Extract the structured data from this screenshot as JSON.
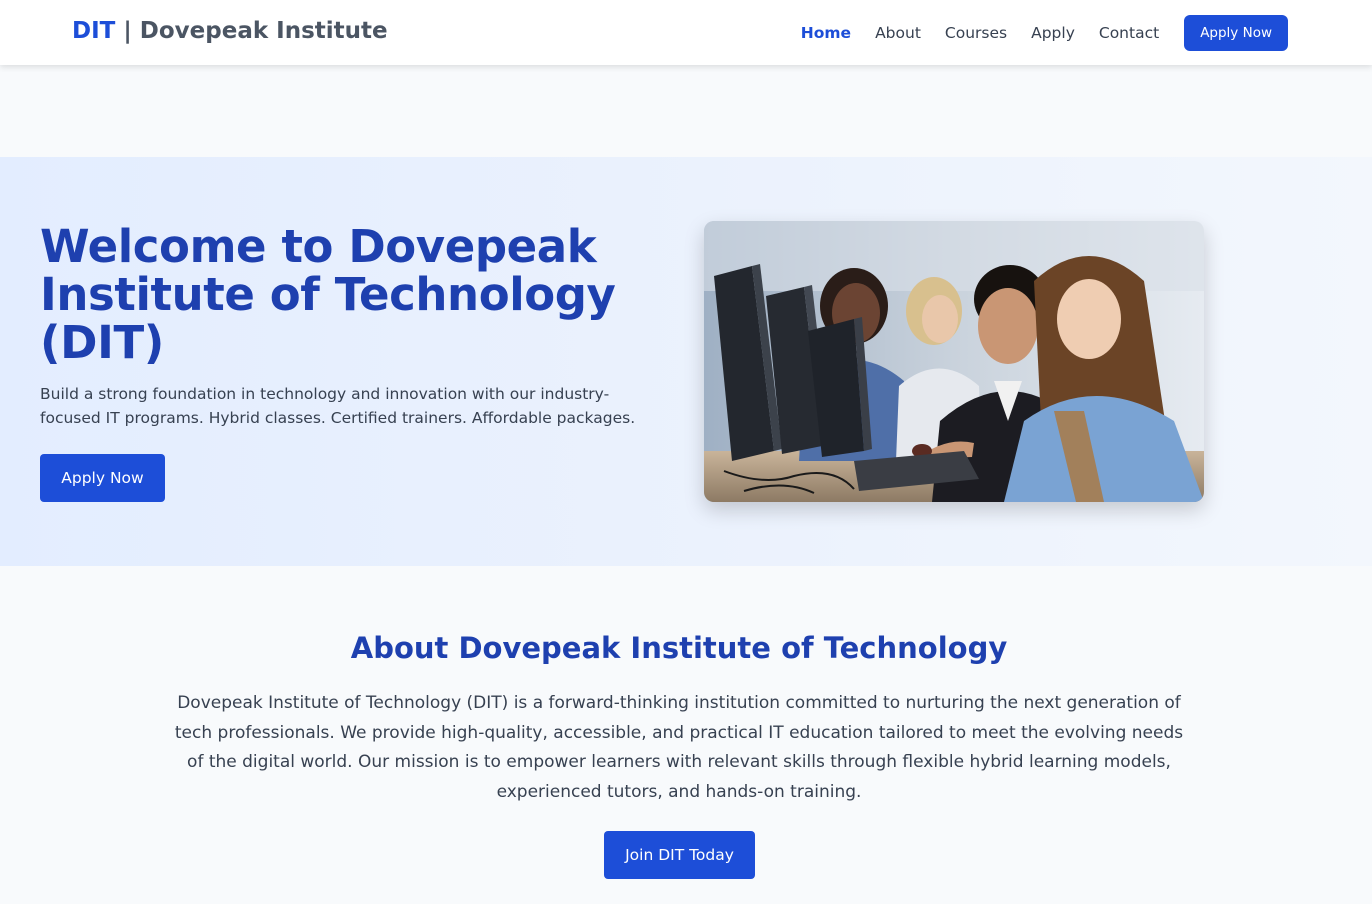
{
  "header": {
    "brand_short": "DIT",
    "brand_separator": " | ",
    "brand_name": "Dovepeak Institute",
    "nav": [
      "Home",
      "About",
      "Courses",
      "Apply",
      "Contact"
    ],
    "active_nav": "Home",
    "cta_label": "Apply Now"
  },
  "hero": {
    "title": "Welcome to Dovepeak Institute of Technology (DIT)",
    "subtitle": "Build a strong foundation in technology and innovation with our industry-focused IT programs. Hybrid classes. Certified trainers. Affordable packages.",
    "cta_label": "Apply Now",
    "image_icon": "students-at-computers-photo"
  },
  "about": {
    "title": "About Dovepeak Institute of Technology",
    "text": "Dovepeak Institute of Technology (DIT) is a forward-thinking institution committed to nurturing the next generation of tech professionals. We provide high-quality, accessible, and practical IT education tailored to meet the evolving needs of the digital world. Our mission is to empower learners with relevant skills through flexible hybrid learning models, experienced tutors, and hands-on training.",
    "cta_label": "Join DIT Today"
  },
  "colors": {
    "primary": "#1d4ed8",
    "heading": "#1e40af",
    "body_text": "#374151",
    "hero_bg": "#e3edff",
    "page_bg": "#f8fafc"
  }
}
